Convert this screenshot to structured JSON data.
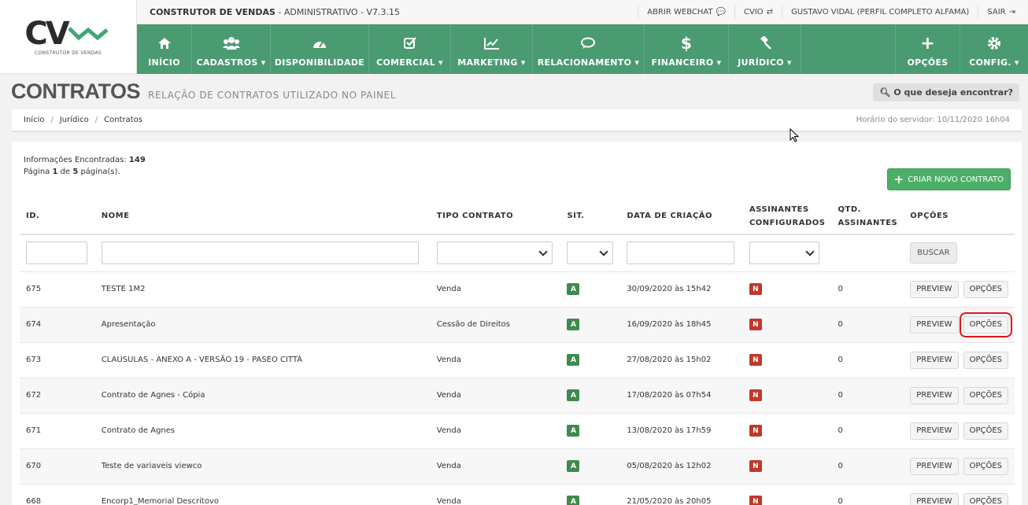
{
  "brand": {
    "logo_text": "CV",
    "logo_sub": "CONSTRUTOR DE VENDAS",
    "accent": "#4a9a72"
  },
  "topbar": {
    "app_name": "CONSTRUTOR DE VENDAS",
    "app_suffix": " - ADMINISTRATIVO - V7.3.15",
    "webchat": "ABRIR WEBCHAT",
    "cvio": "CVIO",
    "user": "GUSTAVO VIDAL (PERFIL COMPLETO ALFAMA)",
    "logout": "SAIR"
  },
  "nav": {
    "items": [
      {
        "label": "INÍCIO",
        "icon": "home-icon"
      },
      {
        "label": "CADASTROS ▾",
        "icon": "users-icon"
      },
      {
        "label": "DISPONIBILIDADE",
        "icon": "dashboard-icon"
      },
      {
        "label": "COMERCIAL ▾",
        "icon": "checkbox-icon"
      },
      {
        "label": "MARKETING ▾",
        "icon": "chart-icon"
      },
      {
        "label": "RELACIONAMENTO ▾",
        "icon": "chat-icon"
      },
      {
        "label": "FINANCEIRO ▾",
        "icon": "dollar-icon"
      },
      {
        "label": "JURÍDICO ▾",
        "icon": "gavel-icon"
      }
    ],
    "right": [
      {
        "label": "OPÇÕES",
        "icon": "plus-icon"
      },
      {
        "label": "CONFIG. ▾",
        "icon": "gear-icon"
      }
    ]
  },
  "page": {
    "title": "CONTRATOS",
    "subtitle": "RELAÇÃO DE CONTRATOS UTILIZADO NO PAINEL",
    "search_label": "O que deseja encontrar?"
  },
  "breadcrumb": {
    "items": [
      "Início",
      "Jurídico",
      "Contratos"
    ],
    "server_time": "Horário do servidor: 10/11/2020 16h04"
  },
  "info": {
    "found_label": "Informações Encontradas: ",
    "found_count": "149",
    "page_prefix": "Página ",
    "page_current": "1",
    "page_mid": " de ",
    "page_total": "5",
    "page_suffix": " página(s)."
  },
  "create_button": "CRIAR NOVO CONTRATO",
  "table": {
    "headers": {
      "id": "ID.",
      "nome": "NOME",
      "tipo": "TIPO CONTRATO",
      "sit": "SIT.",
      "data": "DATA DE CRIAÇÃO",
      "assinantes_1": "ASSINANTES",
      "assinantes_2": "CONFIGURADOS",
      "qtd_1": "QTD.",
      "qtd_2": "ASSINANTES",
      "opcoes": "OPÇÕES"
    },
    "buscar": "BUSCAR",
    "preview_label": "PREVIEW",
    "options_label": "OPÇÕES",
    "rows": [
      {
        "id": "675",
        "nome": "TESTE 1M2",
        "tipo": "Venda",
        "sit": "A",
        "data": "30/09/2020 às 15h42",
        "assin": "N",
        "qtd": "0"
      },
      {
        "id": "674",
        "nome": "Apresentação",
        "tipo": "Cessão de Direitos",
        "sit": "A",
        "data": "16/09/2020 às 18h45",
        "assin": "N",
        "qtd": "0"
      },
      {
        "id": "673",
        "nome": "CLAUSULAS - ANEXO A - VERSÃO 19 - PASEO CITTÀ",
        "tipo": "Venda",
        "sit": "A",
        "data": "27/08/2020 às 15h02",
        "assin": "N",
        "qtd": "0"
      },
      {
        "id": "672",
        "nome": "Contrato de Agnes - Cópia",
        "tipo": "Venda",
        "sit": "A",
        "data": "17/08/2020 às 07h54",
        "assin": "N",
        "qtd": "0"
      },
      {
        "id": "671",
        "nome": "Contrato de Agnes",
        "tipo": "Venda",
        "sit": "A",
        "data": "13/08/2020 às 17h59",
        "assin": "N",
        "qtd": "0"
      },
      {
        "id": "670",
        "nome": "Teste de variaveis viewco",
        "tipo": "Venda",
        "sit": "A",
        "data": "05/08/2020 às 12h02",
        "assin": "N",
        "qtd": "0"
      },
      {
        "id": "668",
        "nome": "Encorp1_Memorial Descritovo",
        "tipo": "Venda",
        "sit": "A",
        "data": "21/05/2020 às 20h05",
        "assin": "N",
        "qtd": "0"
      }
    ]
  }
}
